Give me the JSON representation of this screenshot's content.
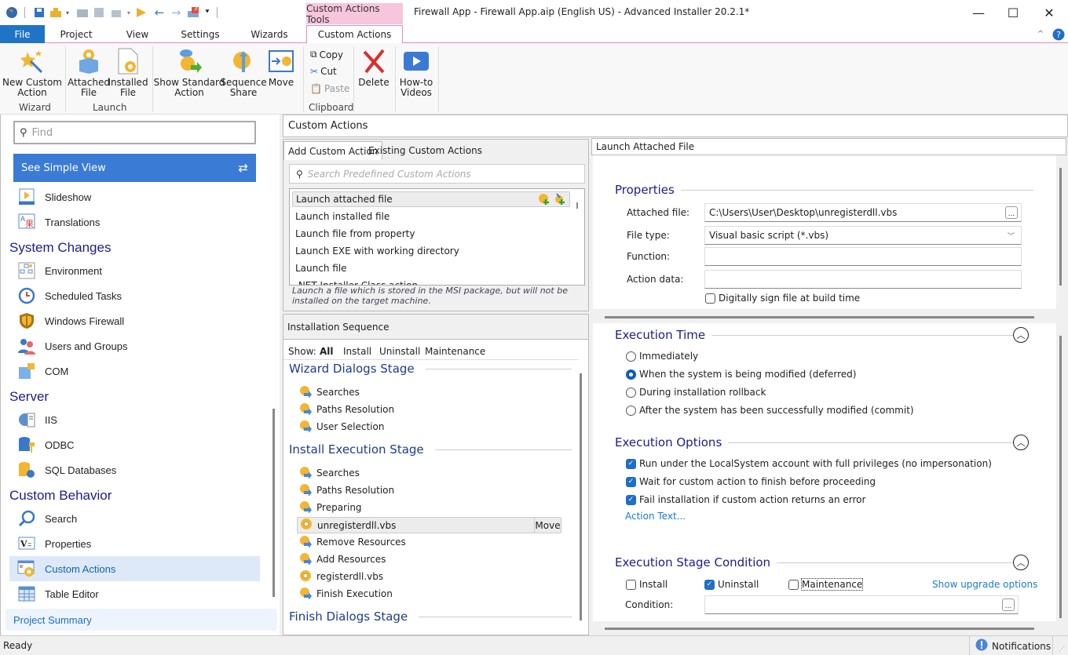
{
  "window": {
    "title": "Firewall App - Firewall App.aip (English US) - Advanced Installer 20.2.1*",
    "context_tab_group": "Custom Actions Tools",
    "notification_badge": "3"
  },
  "menu_tabs": [
    {
      "label": "File"
    },
    {
      "label": "Project"
    },
    {
      "label": "View"
    },
    {
      "label": "Settings"
    },
    {
      "label": "Wizards"
    },
    {
      "label": "Custom Actions",
      "active": true
    }
  ],
  "ribbon": {
    "new_custom_action": "New Custom\nAction",
    "attached_file": "Attached\nFile",
    "installed_file": "Installed\nFile",
    "show_standard_action": "Show Standard\nAction",
    "sequence_share": "Sequence\nShare",
    "move": "Move",
    "copy": "Copy",
    "cut": "Cut",
    "paste": "Paste",
    "delete": "Delete",
    "howto_videos": "How-to\nVideos",
    "groups": {
      "wizard": "Wizard",
      "launch": "Launch",
      "clipboard": "Clipboard"
    }
  },
  "sidebar": {
    "find_placeholder": "Find",
    "simple_view": "See Simple View",
    "items_top": [
      {
        "label": "Slideshow",
        "icon": "slideshow-icon"
      },
      {
        "label": "Translations",
        "icon": "translations-icon"
      }
    ],
    "sections": [
      {
        "title": "System Changes",
        "items": [
          {
            "label": "Environment"
          },
          {
            "label": "Scheduled Tasks"
          },
          {
            "label": "Windows Firewall"
          },
          {
            "label": "Users and Groups"
          },
          {
            "label": "COM"
          }
        ]
      },
      {
        "title": "Server",
        "items": [
          {
            "label": "IIS"
          },
          {
            "label": "ODBC"
          },
          {
            "label": "SQL Databases"
          }
        ]
      },
      {
        "title": "Custom Behavior",
        "items": [
          {
            "label": "Search"
          },
          {
            "label": "Properties"
          },
          {
            "label": "Custom Actions",
            "selected": true
          },
          {
            "label": "Table Editor"
          }
        ]
      }
    ],
    "project_summary": "Project Summary"
  },
  "main": {
    "header": "Custom Actions",
    "tabs": [
      "Add Custom Action",
      "Existing Custom Actions"
    ],
    "search_placeholder": "Search Predefined Custom Actions",
    "predefined": [
      "Launch attached file",
      "Launch installed file",
      "Launch file from property",
      "Launch EXE with working directory",
      "Launch file",
      ".NET Installer Class action"
    ],
    "description": "Launch a file which is stored in the MSI package, but will not be installed on the target machine.",
    "sequence": {
      "header": "Installation Sequence",
      "show_label": "Show:",
      "filters": [
        "All",
        "Install",
        "Uninstall",
        "Maintenance"
      ],
      "stages": [
        {
          "title": "Wizard Dialogs Stage",
          "items": [
            "Searches",
            "Paths Resolution",
            "User Selection"
          ]
        },
        {
          "title": "Install Execution Stage",
          "items": [
            "Searches",
            "Paths Resolution",
            "Preparing",
            "unregisterdll.vbs",
            "Remove Resources",
            "Add Resources",
            "registerdll.vbs",
            "Finish Execution"
          ]
        },
        {
          "title": "Finish Dialogs Stage",
          "items": []
        }
      ],
      "move_label": "Move"
    }
  },
  "details": {
    "header": "Launch Attached File",
    "properties_title": "Properties",
    "attached_file_label": "Attached file:",
    "attached_file_value": "C:\\Users\\User\\Desktop\\unregisterdll.vbs",
    "file_type_label": "File type:",
    "file_type_value": "Visual basic script (*.vbs)",
    "function_label": "Function:",
    "function_value": "",
    "action_data_label": "Action data:",
    "action_data_value": "",
    "sign_label": "Digitally sign file at build time",
    "sign_checked": false,
    "execution_time_title": "Execution Time",
    "execution_time_options": [
      {
        "label": "Immediately",
        "selected": false
      },
      {
        "label": "When the system is being modified (deferred)",
        "selected": true
      },
      {
        "label": "During installation rollback",
        "selected": false
      },
      {
        "label": "After the system has been successfully modified (commit)",
        "selected": false
      }
    ],
    "execution_options_title": "Execution Options",
    "execution_options": [
      {
        "label": "Run under the LocalSystem account with full privileges (no impersonation)",
        "checked": true
      },
      {
        "label": "Wait for custom action to finish before proceeding",
        "checked": true
      },
      {
        "label": "Fail installation if custom action returns an error",
        "checked": true
      }
    ],
    "action_text_link": "Action Text...",
    "stage_condition_title": "Execution Stage Condition",
    "stage_conditions": [
      {
        "label": "Install",
        "checked": false
      },
      {
        "label": "Uninstall",
        "checked": true
      },
      {
        "label": "Maintenance",
        "checked": false
      }
    ],
    "upgrade_link": "Show upgrade options",
    "condition_label": "Condition:",
    "condition_value": ""
  },
  "statusbar": {
    "status": "Ready",
    "notifications": "Notifications"
  }
}
